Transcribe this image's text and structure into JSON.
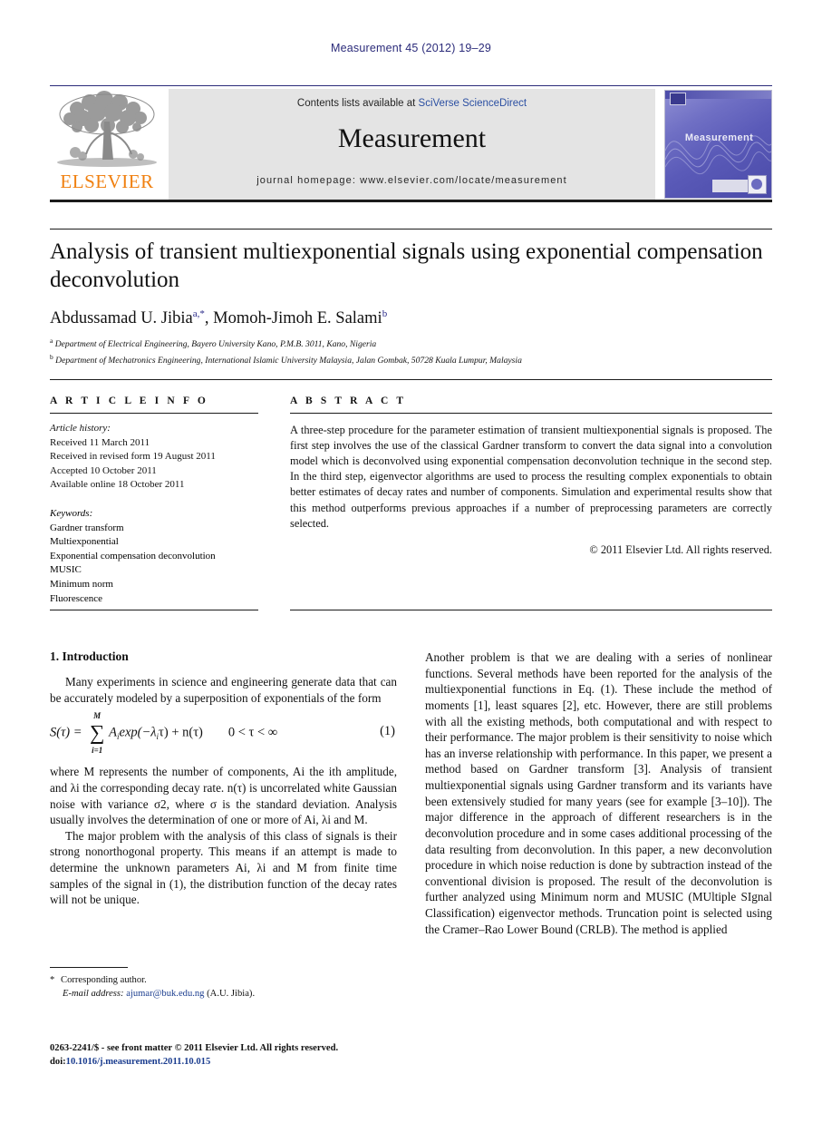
{
  "running_head": "Measurement 45 (2012) 19–29",
  "masthead": {
    "contents_prefix": "Contents lists available at ",
    "contents_link": "SciVerse ScienceDirect",
    "journal_name": "Measurement",
    "homepage": "journal homepage: www.elsevier.com/locate/measurement",
    "publisher_logo_text": "ELSEVIER",
    "cover_title": "Measurement",
    "accent_orange": "#f08010",
    "accent_link_blue": "#2b4fa2",
    "cover_purple": "#5a5ab8"
  },
  "article": {
    "title": "Analysis of transient multiexponential signals using exponential compensation deconvolution",
    "authors": [
      {
        "name": "Abdussamad U. Jibia",
        "marks": "a,*"
      },
      {
        "name": "Momoh-Jimoh E. Salami",
        "marks": "b"
      }
    ],
    "authors_separator": ", ",
    "affiliations": [
      {
        "mark": "a",
        "text": "Department of Electrical Engineering, Bayero University Kano, P.M.B. 3011, Kano, Nigeria"
      },
      {
        "mark": "b",
        "text": "Department of Mechatronics Engineering, International Islamic University Malaysia, Jalan Gombak, 50728 Kuala Lumpur, Malaysia"
      }
    ]
  },
  "article_info": {
    "heading": "A R T I C L E   I N F O",
    "history_label": "Article history:",
    "history": [
      "Received 11 March 2011",
      "Received in revised form 19 August 2011",
      "Accepted 10 October 2011",
      "Available online 18 October 2011"
    ],
    "keywords_label": "Keywords:",
    "keywords": [
      "Gardner transform",
      "Multiexponential",
      "Exponential compensation deconvolution",
      "MUSIC",
      "Minimum norm",
      "Fluorescence"
    ]
  },
  "abstract": {
    "heading": "A B S T R A C T",
    "text": "A three-step procedure for the parameter estimation of transient multiexponential signals is proposed. The first step involves the use of the classical Gardner transform to convert the data signal into a convolution model which is deconvolved using exponential compensation deconvolution technique in the second step. In the third step, eigenvector algorithms are used to process the resulting complex exponentials to obtain better estimates of decay rates and number of components. Simulation and experimental results show that this method outperforms previous approaches if a number of preprocessing parameters are correctly selected.",
    "copyright": "© 2011 Elsevier Ltd. All rights reserved."
  },
  "body": {
    "section_heading": "1. Introduction",
    "left_paragraph_1": "Many experiments in science and engineering generate data that can be accurately modeled by a superposition of exponentials of the form",
    "equation": {
      "lhs": "S(τ) =",
      "sum_upper": "M",
      "sum_lower": "i=1",
      "sum_symbol": "∑",
      "body": "A",
      "body_sub": "i",
      "body_rest": "exp(−λ",
      "body_rest_sub": "i",
      "body_tail": "τ) + n(τ)",
      "condition": "0 < τ < ∞",
      "number": "(1)"
    },
    "left_paragraph_2_a": "where ",
    "left_paragraph_2": "where M represents the number of components, Ai the ith amplitude, and λi the corresponding decay rate. n(τ) is uncorrelated white Gaussian noise with variance σ2, where σ is the standard deviation. Analysis usually involves the determination of one or more of Ai, λi and M.",
    "left_paragraph_3": "The major problem with the analysis of this class of signals is their strong nonorthogonal property. This means if an attempt is made to determine the unknown parameters Ai, λi and M from finite time samples of the signal in (1), the distribution function of the decay rates will not be unique.",
    "right_paragraph_1": "Another problem is that we are dealing with a series of nonlinear functions. Several methods have been reported for the analysis of the multiexponential functions in Eq. (1). These include the method of moments [1], least squares [2], etc. However, there are still problems with all the existing methods, both computational and with respect to their performance. The major problem is their sensitivity to noise which has an inverse relationship with performance. In this paper, we present a method based on Gardner transform [3]. Analysis of transient multiexponential signals using Gardner transform and its variants have been extensively studied for many years (see for example [3–10]). The major difference in the approach of different researchers is in the deconvolution procedure and in some cases additional processing of the data resulting from deconvolution. In this paper, a new deconvolution procedure in which noise reduction is done by subtraction instead of the conventional division is proposed. The result of the deconvolution is further analyzed using Minimum norm and MUSIC (MUltiple SIgnal Classification) eigenvector methods. Truncation point is selected using the Cramer–Rao Lower Bound (CRLB). The method is applied"
  },
  "footnotes": {
    "corresponding_marker": "*",
    "corresponding_text": "Corresponding author.",
    "email_label": "E-mail address:",
    "email": "ajumar@buk.edu.ng",
    "email_owner": "(A.U. Jibia).",
    "imprint_line": "0263-2241/$ - see front matter © 2011 Elsevier Ltd. All rights reserved.",
    "doi_label": "doi:",
    "doi": "10.1016/j.measurement.2011.10.015"
  }
}
